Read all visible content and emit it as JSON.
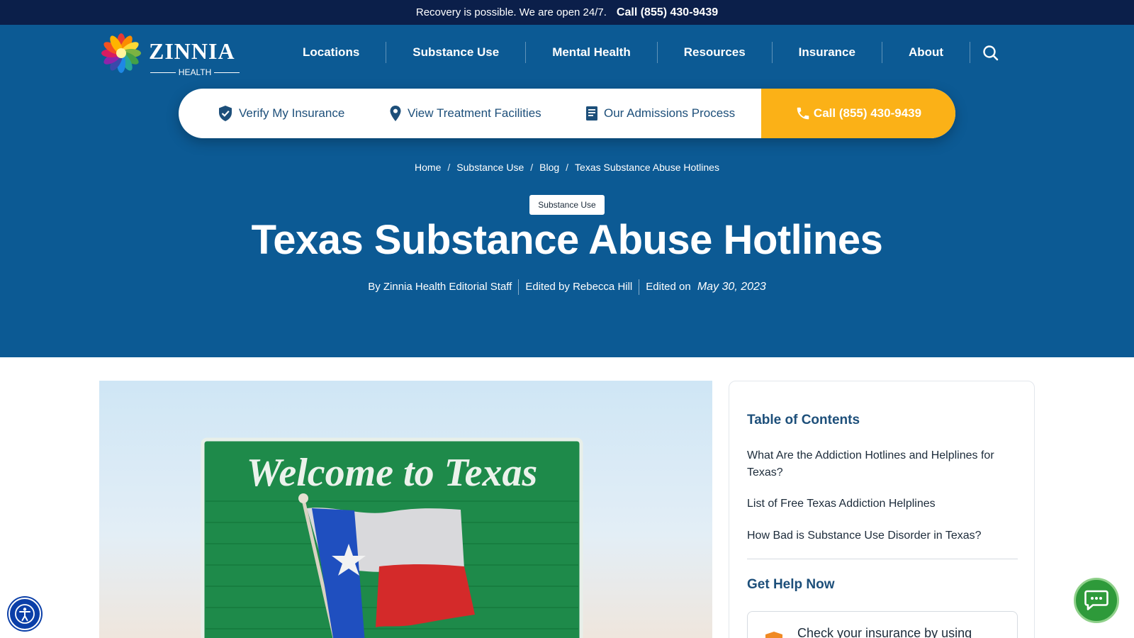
{
  "topbar": {
    "message": "Recovery is possible. We are open 24/7.",
    "phone": "Call (855) 430-9439"
  },
  "logo": {
    "name": "ZINNIA",
    "sub": "HEALTH"
  },
  "nav": {
    "items": [
      {
        "label": "Locations"
      },
      {
        "label": "Substance Use"
      },
      {
        "label": "Mental Health"
      },
      {
        "label": "Resources"
      },
      {
        "label": "Insurance"
      },
      {
        "label": "About"
      }
    ]
  },
  "actions": {
    "verify": "Verify My Insurance",
    "facilities": "View Treatment Facilities",
    "admissions": "Our Admissions Process",
    "call": "Call (855) 430-9439"
  },
  "breadcrumb": {
    "items": [
      "Home",
      "Substance Use",
      "Blog",
      "Texas Substance Abuse Hotlines"
    ],
    "separator": "/"
  },
  "article": {
    "category": "Substance Use",
    "title": "Texas Substance Abuse Hotlines",
    "author": "By Zinnia Health Editorial Staff",
    "editor": "Edited by Rebecca Hill",
    "edited_label": "Edited on",
    "edited_date": "May 30, 2023"
  },
  "feature_image": {
    "sign_text": "Welcome to Texas"
  },
  "sidebar": {
    "toc_title": "Table of Contents",
    "toc_items": [
      "What Are the Addiction Hotlines and Helplines for Texas?",
      "List of Free Texas Addiction Helplines",
      "How Bad is Substance Use Disorder in Texas?"
    ],
    "help_title": "Get Help Now",
    "help_card_text": "Check your insurance by using"
  },
  "colors": {
    "hero": "#0c5a94",
    "topbar": "#0b1f4a",
    "call_accent": "#fbb117",
    "heading_blue": "#1d4f7a",
    "chat_green": "#2e9a3a"
  },
  "icons": {
    "search": "search-icon",
    "shield": "shield-check-icon",
    "pin": "map-pin-icon",
    "document": "document-icon",
    "phone": "phone-icon",
    "accessibility": "accessibility-icon",
    "chat": "chat-icon"
  }
}
